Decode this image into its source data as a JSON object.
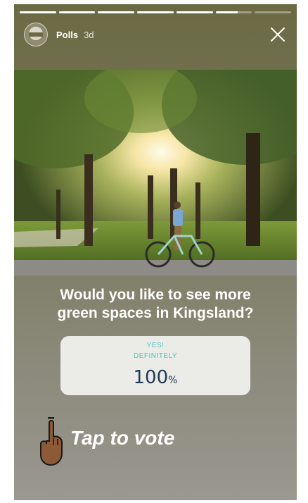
{
  "story": {
    "progress_segments": [
      1,
      1,
      1,
      1,
      1,
      0.6,
      0
    ],
    "account_name": "Polls",
    "time_ago": "3d"
  },
  "question": {
    "line1": "Would you like to see more",
    "line2": "green spaces in Kingsland?"
  },
  "poll": {
    "option_line1": "YES!",
    "option_line2": "DEFINITELY",
    "percent_value": "100",
    "percent_sign": "%"
  },
  "cta": {
    "label": "Tap to vote"
  },
  "colors": {
    "poll_accent": "#4fc7c0",
    "poll_text": "#223a57"
  },
  "icons": [
    "close-icon",
    "pointing-hand-icon"
  ]
}
